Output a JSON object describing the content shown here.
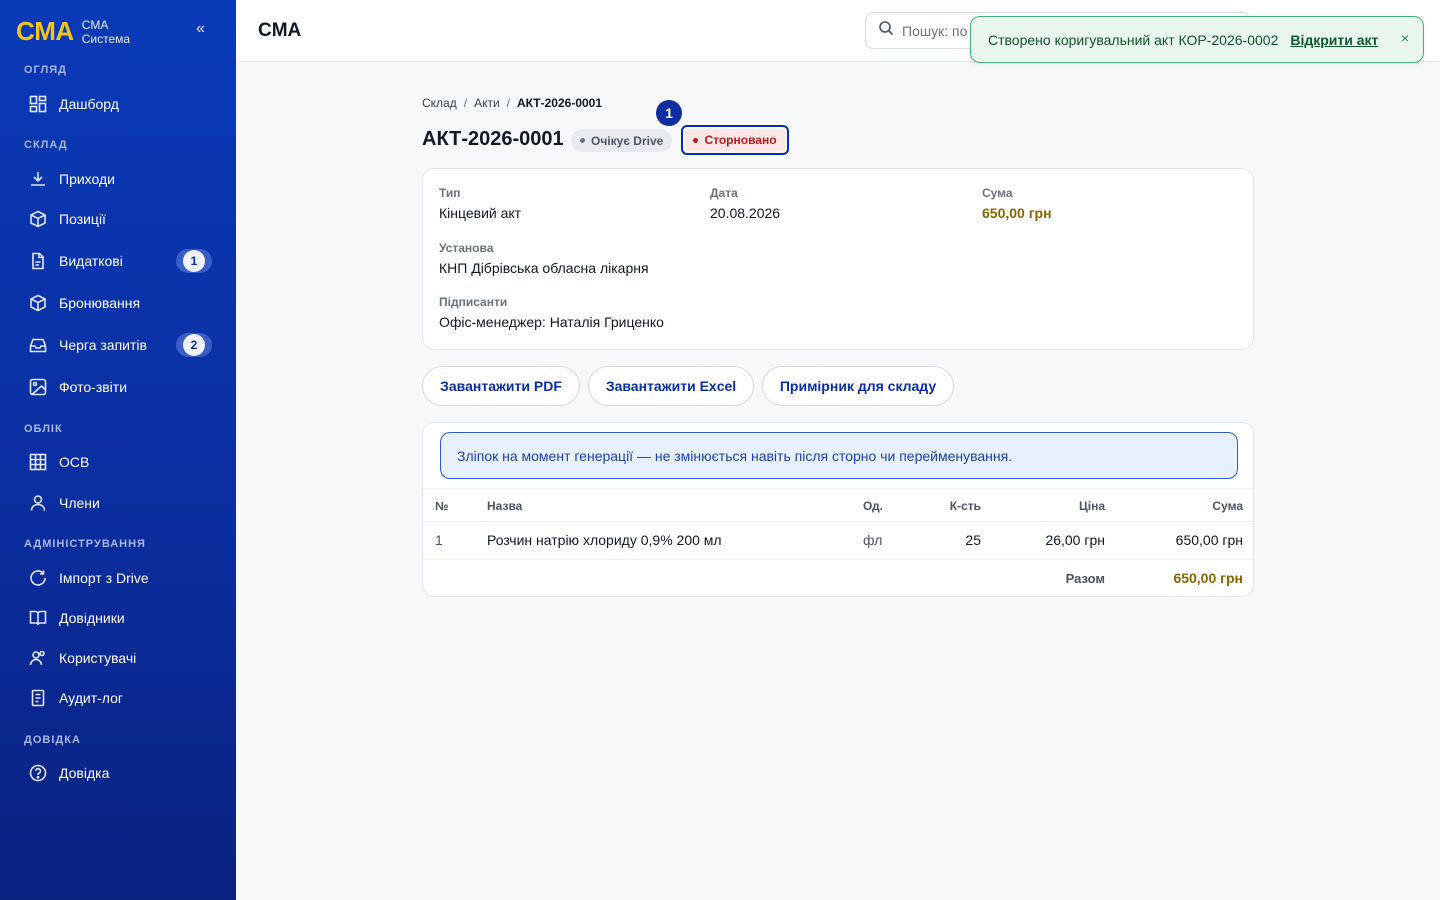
{
  "brand": {
    "logo": "CMA",
    "line1": "CMA",
    "line2": "Система",
    "collapse": "«"
  },
  "sidebar": {
    "sections": [
      {
        "label": "ОГЛЯД"
      },
      {
        "label": "СКЛАД"
      },
      {
        "label": "ОБЛІК"
      },
      {
        "label": "АДМІНІСТРУВАННЯ"
      },
      {
        "label": "ДОВІДКА"
      }
    ],
    "items": [
      {
        "label": "Дашборд",
        "icon": "dashboard-icon"
      },
      {
        "label": "Приходи",
        "icon": "download-icon"
      },
      {
        "label": "Позиції",
        "icon": "box-icon"
      },
      {
        "label": "Видаткові",
        "icon": "document-icon",
        "badge": "1"
      },
      {
        "label": "Бронювання",
        "icon": "box-icon"
      },
      {
        "label": "Черга запитів",
        "icon": "inbox-icon",
        "badge": "2"
      },
      {
        "label": "Фото-звіти",
        "icon": "image-icon"
      },
      {
        "label": "ОСВ",
        "icon": "table-icon"
      },
      {
        "label": "Члени",
        "icon": "user-icon"
      },
      {
        "label": "Імпорт з Drive",
        "icon": "refresh-icon"
      },
      {
        "label": "Довідники",
        "icon": "book-icon"
      },
      {
        "label": "Користувачі",
        "icon": "users-icon"
      },
      {
        "label": "Аудит-лог",
        "icon": "audit-icon"
      },
      {
        "label": "Довідка",
        "icon": "help-icon"
      }
    ]
  },
  "header": {
    "title": "CMA",
    "search_placeholder": "Пошук: по"
  },
  "toast": {
    "message": "Створено коригувальний акт КОР-2026-0002",
    "link": "Відкрити акт",
    "close": "×",
    "accent": "#41b37a"
  },
  "breadcrumb": {
    "items": [
      "Склад",
      "Акти"
    ],
    "current": "АКТ-2026-0001",
    "sep": "/"
  },
  "page": {
    "title": "АКТ-2026-0001",
    "badge_drive": "Очікує Drive",
    "badge_status": "Сторновано",
    "step_marker": "1"
  },
  "info": {
    "type_label": "Тип",
    "type_value": "Кінцевий акт",
    "date_label": "Дата",
    "date_value": "20.08.2026",
    "sum_label": "Сума",
    "sum_value": "650,00 грн",
    "org_label": "Установа",
    "org_value": "КНП Дібрівська обласна лікарня",
    "signers_label": "Підписанти",
    "signers_value": "Офіс-менеджер: Наталія Гриценко"
  },
  "actions": {
    "pdf": "Завантажити PDF",
    "excel": "Завантажити Excel",
    "copy": "Примірник для складу"
  },
  "notice": "Зліпок на момент генерації — не змінюється навіть після сторно чи перейменування.",
  "table": {
    "headers": {
      "num": "№",
      "name": "Назва",
      "unit": "Од.",
      "qty": "К-сть",
      "price": "Ціна",
      "sum": "Сума"
    },
    "rows": [
      {
        "num": "1",
        "name": "Розчин натрію хлориду 0,9% 200 мл",
        "unit": "фл",
        "qty": "25",
        "price": "26,00 грн",
        "sum": "650,00 грн"
      }
    ],
    "total_label": "Разом",
    "total_value": "650,00 грн"
  },
  "colors": {
    "primary": "#0b2ea0",
    "accent_gold": "#f5c518",
    "sum": "#8a6500",
    "danger": "#b91c1c"
  }
}
